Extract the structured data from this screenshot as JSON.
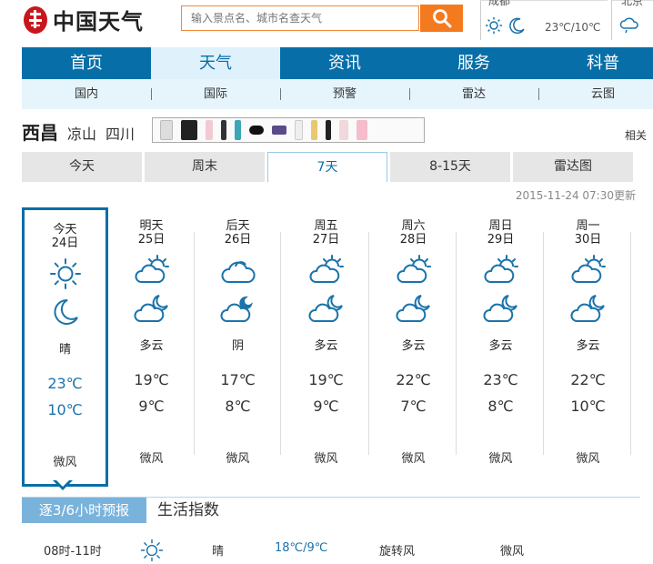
{
  "header": {
    "logo_text": "中国天气",
    "search_placeholder": "输入景点名、城市名查天气",
    "weather_city_1": "成都",
    "weather_temp_1": "23℃/10℃",
    "weather_city_2": "北京"
  },
  "nav": [
    {
      "label": "首页"
    },
    {
      "label": "天气"
    },
    {
      "label": "资讯"
    },
    {
      "label": "服务"
    },
    {
      "label": "科普"
    }
  ],
  "subnav": [
    {
      "label": "国内"
    },
    {
      "label": "国际"
    },
    {
      "label": "预警"
    },
    {
      "label": "雷达"
    },
    {
      "label": "云图"
    }
  ],
  "location": {
    "city": "西昌",
    "prefecture": "凉山",
    "province": "四川",
    "related": "相关"
  },
  "tabs": [
    {
      "label": "今天"
    },
    {
      "label": "周末"
    },
    {
      "label": "7天"
    },
    {
      "label": "8-15天"
    },
    {
      "label": "雷达图"
    }
  ],
  "update_time": "2015-11-24 07:30更新",
  "days": [
    {
      "label": "今天",
      "date": "24日",
      "cond": "晴",
      "high": "23℃",
      "low": "10℃",
      "wind": "微风",
      "day_icon": "sun-icon",
      "night_icon": "moon-icon"
    },
    {
      "label": "明天",
      "date": "25日",
      "cond": "多云",
      "high": "19℃",
      "low": "9℃",
      "wind": "微风",
      "day_icon": "partly-cloudy-day-icon",
      "night_icon": "partly-cloudy-night-icon"
    },
    {
      "label": "后天",
      "date": "26日",
      "cond": "阴",
      "high": "17℃",
      "low": "8℃",
      "wind": "微风",
      "day_icon": "cloud-icon",
      "night_icon": "overcast-night-icon"
    },
    {
      "label": "周五",
      "date": "27日",
      "cond": "多云",
      "high": "19℃",
      "low": "9℃",
      "wind": "微风",
      "day_icon": "partly-cloudy-day-icon",
      "night_icon": "partly-cloudy-night-icon"
    },
    {
      "label": "周六",
      "date": "28日",
      "cond": "多云",
      "high": "22℃",
      "low": "7℃",
      "wind": "微风",
      "day_icon": "partly-cloudy-day-icon",
      "night_icon": "partly-cloudy-night-icon"
    },
    {
      "label": "周日",
      "date": "29日",
      "cond": "多云",
      "high": "23℃",
      "low": "8℃",
      "wind": "微风",
      "day_icon": "partly-cloudy-day-icon",
      "night_icon": "partly-cloudy-night-icon"
    },
    {
      "label": "周一",
      "date": "30日",
      "cond": "多云",
      "high": "22℃",
      "low": "10℃",
      "wind": "微风",
      "day_icon": "partly-cloudy-day-icon",
      "night_icon": "partly-cloudy-night-icon"
    }
  ],
  "section_tabs": {
    "hourly": "逐3/6小时预报",
    "life_index": "生活指数"
  },
  "hourly_row": {
    "time": "08时-11时",
    "icon": "sun-icon",
    "cond": "晴",
    "temp": "18℃/9℃",
    "wind_dir": "旋转风",
    "wind": "微风"
  },
  "colors": {
    "brand_blue": "#076ea8",
    "search_orange": "#f47a20",
    "icon_blue": "#1a73ab",
    "light_blue": "#e6f4fc",
    "section_tab_blue": "#79b3dc"
  }
}
